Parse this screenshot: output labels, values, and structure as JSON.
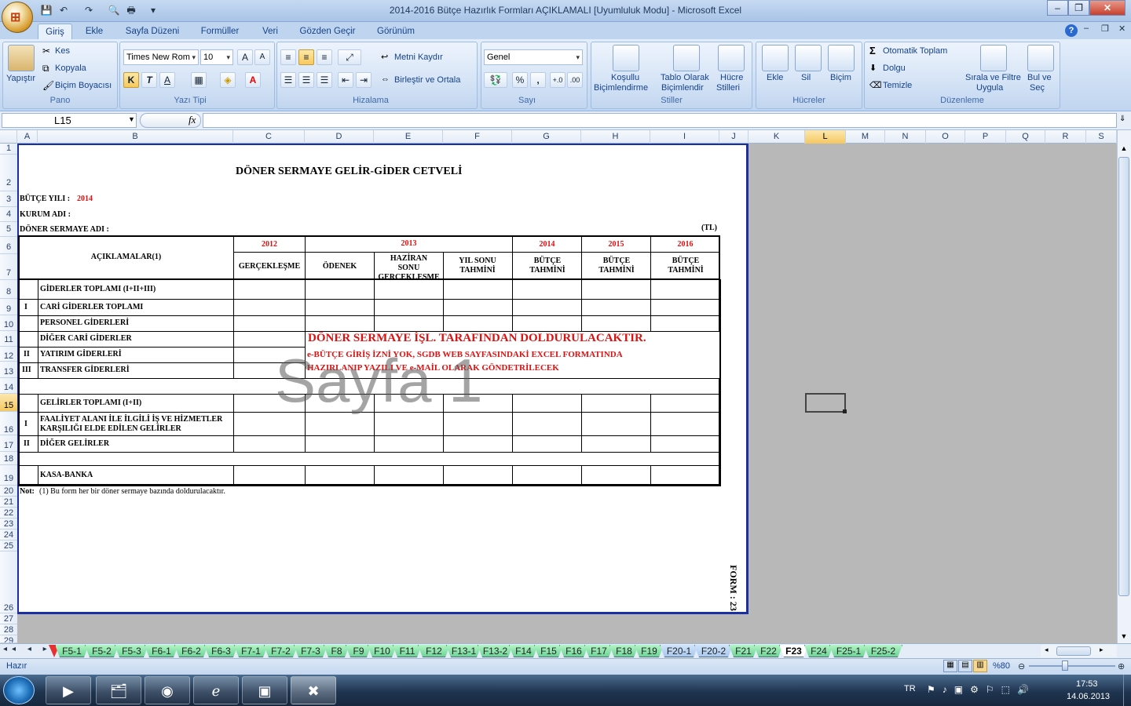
{
  "window": {
    "title": "2014-2016 Bütçe Hazırlık Formları AÇIKLAMALI  [Uyumluluk Modu] - Microsoft Excel",
    "minimize": "–",
    "restore": "❐",
    "close": "✕"
  },
  "ribbon_tabs": [
    "Giriş",
    "Ekle",
    "Sayfa Düzeni",
    "Formüller",
    "Veri",
    "Gözden Geçir",
    "Görünüm"
  ],
  "groups": {
    "clipboard": "Pano",
    "font": "Yazı Tipi",
    "alignment": "Hizalama",
    "number": "Sayı",
    "styles": "Stiller",
    "cells": "Hücreler",
    "editing": "Düzenleme"
  },
  "clipboard": {
    "paste": "Yapıştır",
    "cut": "Kes",
    "copy": "Kopyala",
    "format_painter": "Biçim Boyacısı"
  },
  "font": {
    "name": "Times New Rom",
    "size": "10",
    "bold": "K",
    "italic": "T",
    "underline": "A",
    "fontcolor": "A"
  },
  "alignment": {
    "wrap": "Metni Kaydır",
    "merge": "Birleştir ve Ortala"
  },
  "number": {
    "format": "Genel",
    "percent": "%",
    "comma": ","
  },
  "styles": {
    "conditional": "Koşullu",
    "conditional2": "Biçimlendirme",
    "table": "Tablo Olarak",
    "table2": "Biçimlendir",
    "cellstyles": "Hücre",
    "cellstyles2": "Stilleri"
  },
  "cells": {
    "insert": "Ekle",
    "delete": "Sil",
    "format": "Biçim"
  },
  "editing": {
    "autosum": "Otomatik Toplam",
    "fill": "Dolgu",
    "clear": "Temizle",
    "sort": "Sırala ve Filtre",
    "sort2": "Uygula",
    "find": "Bul ve",
    "find2": "Seç"
  },
  "formula_bar": {
    "name_box": "L15",
    "fx": "fx",
    "value": ""
  },
  "columns": [
    "A",
    "B",
    "C",
    "D",
    "E",
    "F",
    "G",
    "H",
    "I",
    "J",
    "K",
    "L",
    "M",
    "N",
    "O",
    "P",
    "Q",
    "R",
    "S"
  ],
  "rows": [
    "1",
    "2",
    "3",
    "4",
    "5",
    "6",
    "7",
    "8",
    "9",
    "10",
    "11",
    "12",
    "13",
    "14",
    "15",
    "16",
    "17",
    "18",
    "19",
    "20",
    "21",
    "22",
    "23",
    "24",
    "25",
    "26",
    "27",
    "28",
    "29"
  ],
  "sheet": {
    "title": "DÖNER SERMAYE GELİR-GİDER CETVELİ",
    "budget_year_label": "BÜTÇE YILI :",
    "budget_year": "2014",
    "institution_label": "KURUM ADI :",
    "fund_label": "DÖNER SERMAYE ADI :",
    "currency": "(TL)",
    "header": {
      "desc": "AÇIKLAMALAR(1)",
      "y2012": "2012",
      "y2013": "2013",
      "y2014": "2014",
      "y2015": "2015",
      "y2016": "2016",
      "c_real": "GERÇEKLEŞME",
      "d_appr": "ÖDENEK",
      "e_june": "HAZİRAN SONU",
      "e_june2": "GERÇEKLEŞME",
      "f_est": "YIL SONU TAHMİNİ",
      "g_bud": "BÜTÇE TAHMİNİ",
      "h_bud": "BÜTÇE TAHMİNİ",
      "i_bud": "BÜTÇE TAHMİNİ"
    },
    "lines": {
      "r8": "GİDERLER TOPLAMI (I+II+III)",
      "r9n": "I",
      "r9": "CARİ GİDERLER TOPLAMI",
      "r10": "PERSONEL GİDERLERİ",
      "r11": "DİĞER CARİ GİDERLER",
      "r12n": "II",
      "r12": "YATIRIM GİDERLERİ",
      "r13n": "III",
      "r13": "TRANSFER GİDERLERİ",
      "r15": "GELİRLER TOPLAMI (I+II)",
      "r16n": "I",
      "r16": "FAALİYET ALANI İLE İLGİLİ İŞ VE HİZMETLER KARŞILIĞI ELDE EDİLEN GELİRLER",
      "r17n": "II",
      "r17": "DİĞER GELİRLER",
      "r19": "KASA-BANKA"
    },
    "notice": "DÖNER SERMAYE İŞL. TARAFINDAN DOLDURULACAKTIR.",
    "notice2": "e-BÜTÇE GİRİŞ İZNİ YOK, SGDB WEB SAYFASINDAKİ EXCEL FORMATINDA",
    "notice3": "HAZIRLANIP YAZILI VE e-MAİL OLARAK GÖNDETRİLECEK",
    "note_label": "Not:",
    "note": "(1) Bu form her bir döner sermaye bazında doldurulacaktır.",
    "form_no": "FORM : 23",
    "watermark": "Sayfa 1"
  },
  "sheet_tabs": [
    "F5-1",
    "F5-2",
    "F5-3",
    "F6-1",
    "F6-2",
    "F6-3",
    "F7-1",
    "F7-2",
    "F7-3",
    "F8",
    "F9",
    "F10",
    "F11",
    "F12",
    "F13-1",
    "F13-2",
    "F14",
    "F15",
    "F16",
    "F17",
    "F18",
    "F19",
    "F20-1",
    "F20-2",
    "F21",
    "F22",
    "F23",
    "F24",
    "F25-1",
    "F25-2"
  ],
  "status": {
    "ready": "Hazır",
    "zoom": "%80"
  },
  "taskbar": {
    "lang": "TR",
    "time": "17:53",
    "date": "14.06.2013"
  }
}
